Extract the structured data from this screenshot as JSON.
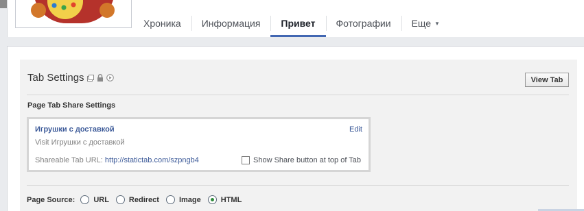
{
  "nav": {
    "items": [
      {
        "label": "Хроника",
        "active": false
      },
      {
        "label": "Информация",
        "active": false
      },
      {
        "label": "Привет",
        "active": true
      },
      {
        "label": "Фотографии",
        "active": false
      },
      {
        "label": "Еще",
        "active": false
      }
    ],
    "more_caret": "▼"
  },
  "tab_settings": {
    "title": "Tab Settings",
    "view_tab_label": "View Tab"
  },
  "share_settings": {
    "heading": "Page Tab Share Settings",
    "app_name": "Игрушки с доставкой",
    "edit_label": "Edit",
    "visit_text": "Visit Игрушки с доставкой",
    "url_label": "Shareable Tab URL: ",
    "url_value": "http://statictab.com/szpngb4",
    "checkbox_label": "Show Share button at top of Tab",
    "checkbox_checked": false
  },
  "page_source": {
    "label": "Page Source:",
    "options": [
      {
        "label": "URL",
        "checked": false
      },
      {
        "label": "Redirect",
        "checked": false
      },
      {
        "label": "Image",
        "checked": false
      },
      {
        "label": "HTML",
        "checked": true
      }
    ]
  },
  "colors": {
    "link": "#3b5998",
    "nav_active_underline": "#4267b2",
    "panel_bg": "#f2f2f2",
    "radio_checked": "#2e8a3a"
  }
}
